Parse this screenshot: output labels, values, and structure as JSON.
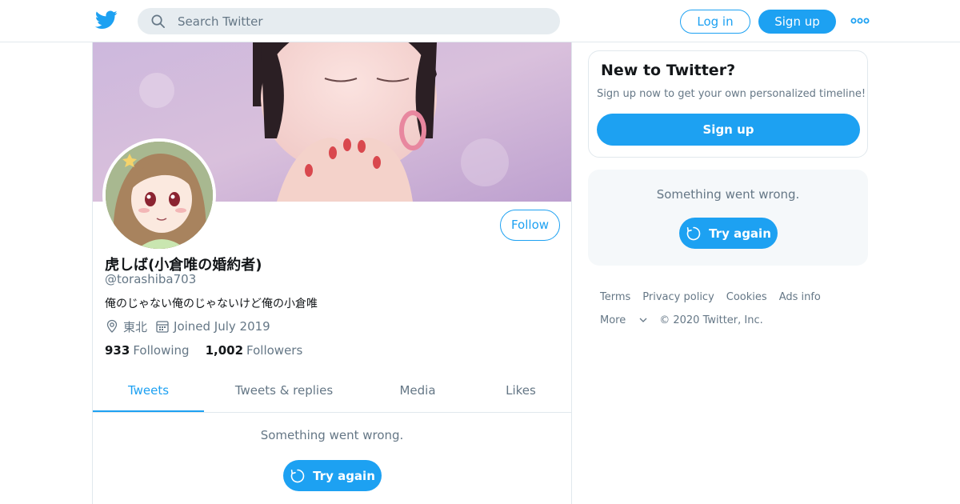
{
  "topbar": {
    "logo_icon": "twitter-bird-icon",
    "search_placeholder": "Search Twitter",
    "login_label": "Log in",
    "signup_label": "Sign up",
    "more_icon": "more-dots-icon"
  },
  "profile": {
    "display_name": "虎しば(小倉唯の婚約者)",
    "handle": "@torashiba703",
    "bio": "俺のじゃない俺のじゃないけど俺の小倉唯",
    "location": "東北",
    "joined": "Joined July 2019",
    "following_count": "933",
    "following_label": "Following",
    "followers_count": "1,002",
    "followers_label": "Followers",
    "follow_label": "Follow"
  },
  "tabs": [
    {
      "label": "Tweets",
      "active": true
    },
    {
      "label": "Tweets & replies",
      "active": false
    },
    {
      "label": "Media",
      "active": false
    },
    {
      "label": "Likes",
      "active": false
    }
  ],
  "main_error": {
    "message": "Something went wrong.",
    "retry_label": "Try again"
  },
  "sidebar": {
    "new_card": {
      "title": "New to Twitter?",
      "subtitle": "Sign up now to get your own personalized timeline!",
      "signup_label": "Sign up"
    },
    "error_card": {
      "message": "Something went wrong.",
      "retry_label": "Try again"
    },
    "footer": {
      "links": [
        "Terms",
        "Privacy policy",
        "Cookies",
        "Ads info"
      ],
      "more_label": "More",
      "copyright": "© 2020 Twitter, Inc."
    }
  },
  "colors": {
    "accent": "#1da1f2",
    "secondary_text": "#657786",
    "border": "#e1e8ed"
  }
}
